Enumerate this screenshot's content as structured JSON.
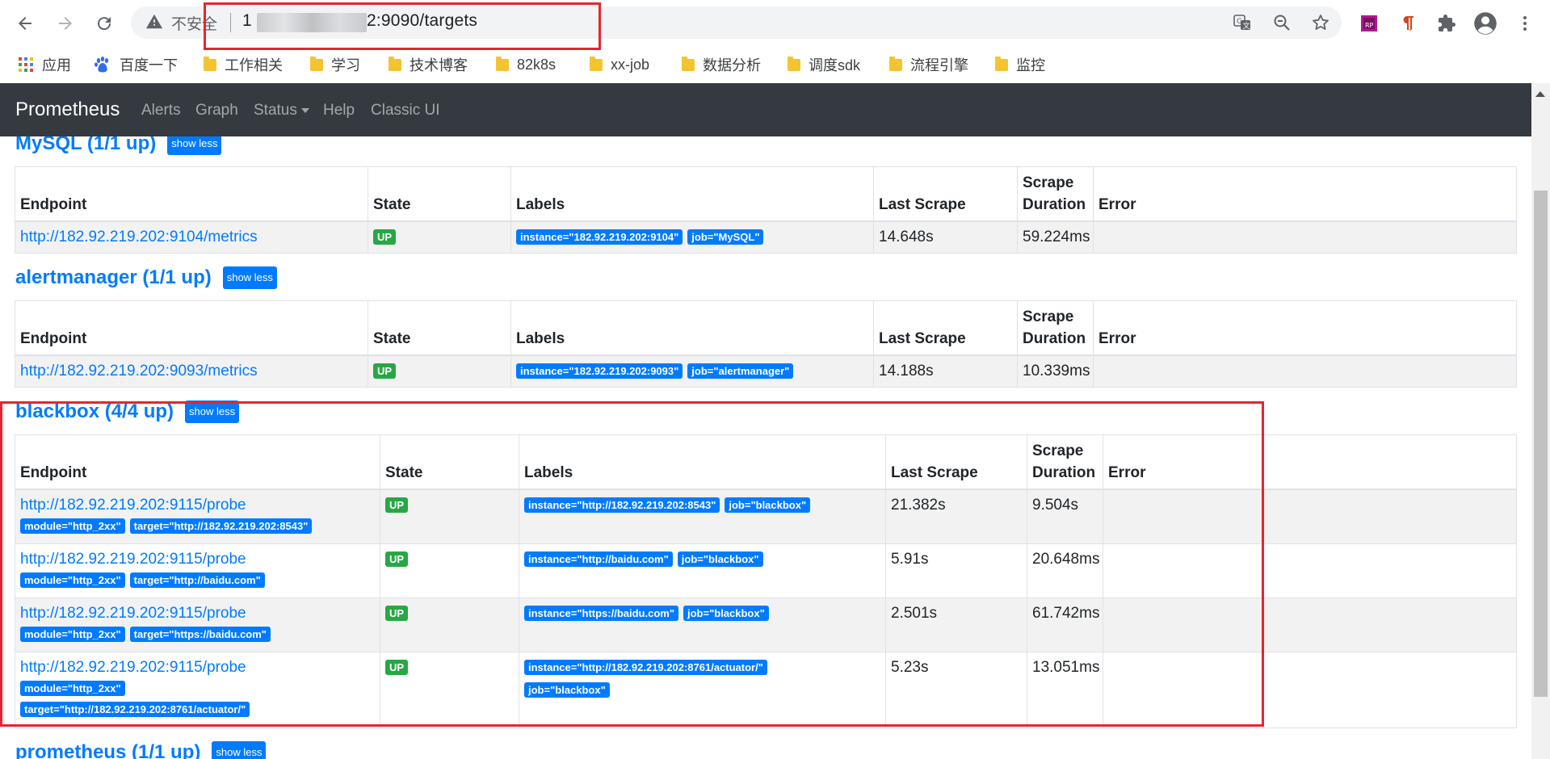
{
  "browser": {
    "security_label": "不安全",
    "url_prefix": "1",
    "url_suffix": "2:9090/targets"
  },
  "bookmarks": [
    {
      "label": "应用",
      "icon": "apps-grid-icon"
    },
    {
      "label": "百度一下",
      "icon": "baidu-paw-icon"
    },
    {
      "label": "工作相关",
      "icon": "folder-icon"
    },
    {
      "label": "学习",
      "icon": "folder-icon"
    },
    {
      "label": "技术博客",
      "icon": "folder-icon"
    },
    {
      "label": "82k8s",
      "icon": "folder-icon"
    },
    {
      "label": "xx-job",
      "icon": "folder-icon"
    },
    {
      "label": "数据分析",
      "icon": "folder-icon"
    },
    {
      "label": "调度sdk",
      "icon": "folder-icon"
    },
    {
      "label": "流程引擎",
      "icon": "folder-icon"
    },
    {
      "label": "监控",
      "icon": "folder-icon"
    }
  ],
  "navbar": {
    "brand": "Prometheus",
    "links": [
      "Alerts",
      "Graph",
      "Status",
      "Help",
      "Classic UI"
    ]
  },
  "table_headers": {
    "endpoint": "Endpoint",
    "state": "State",
    "labels": "Labels",
    "last_scrape": "Last Scrape",
    "scrape_duration": "Scrape Duration",
    "error": "Error"
  },
  "show_less": "show less",
  "pools": [
    {
      "title": "MySQL (1/1 up)",
      "rows": [
        {
          "endpoint": "http://182.92.219.202:9104/metrics",
          "sublabels": [],
          "state": "UP",
          "labels": [
            "instance=\"182.92.219.202:9104\"",
            "job=\"MySQL\""
          ],
          "last_scrape": "14.648s",
          "duration": "59.224ms",
          "error": ""
        }
      ]
    },
    {
      "title": "alertmanager (1/1 up)",
      "rows": [
        {
          "endpoint": "http://182.92.219.202:9093/metrics",
          "sublabels": [],
          "state": "UP",
          "labels": [
            "instance=\"182.92.219.202:9093\"",
            "job=\"alertmanager\""
          ],
          "last_scrape": "14.188s",
          "duration": "10.339ms",
          "error": ""
        }
      ]
    },
    {
      "title": "blackbox (4/4 up)",
      "rows": [
        {
          "endpoint": "http://182.92.219.202:9115/probe",
          "sublabels": [
            "module=\"http_2xx\"",
            "target=\"http://182.92.219.202:8543\""
          ],
          "state": "UP",
          "labels": [
            "instance=\"http://182.92.219.202:8543\"",
            "job=\"blackbox\""
          ],
          "last_scrape": "21.382s",
          "duration": "9.504s",
          "error": ""
        },
        {
          "endpoint": "http://182.92.219.202:9115/probe",
          "sublabels": [
            "module=\"http_2xx\"",
            "target=\"http://baidu.com\""
          ],
          "state": "UP",
          "labels": [
            "instance=\"http://baidu.com\"",
            "job=\"blackbox\""
          ],
          "last_scrape": "5.91s",
          "duration": "20.648ms",
          "error": ""
        },
        {
          "endpoint": "http://182.92.219.202:9115/probe",
          "sublabels": [
            "module=\"http_2xx\"",
            "target=\"https://baidu.com\""
          ],
          "state": "UP",
          "labels": [
            "instance=\"https://baidu.com\"",
            "job=\"blackbox\""
          ],
          "last_scrape": "2.501s",
          "duration": "61.742ms",
          "error": ""
        },
        {
          "endpoint": "http://182.92.219.202:9115/probe",
          "sublabels": [
            "module=\"http_2xx\"",
            "target=\"http://182.92.219.202:8761/actuator/\""
          ],
          "state": "UP",
          "labels": [
            "instance=\"http://182.92.219.202:8761/actuator/\"",
            "job=\"blackbox\""
          ],
          "last_scrape": "5.23s",
          "duration": "13.051ms",
          "error": ""
        }
      ]
    },
    {
      "title": "prometheus (1/1 up)",
      "rows": []
    }
  ]
}
